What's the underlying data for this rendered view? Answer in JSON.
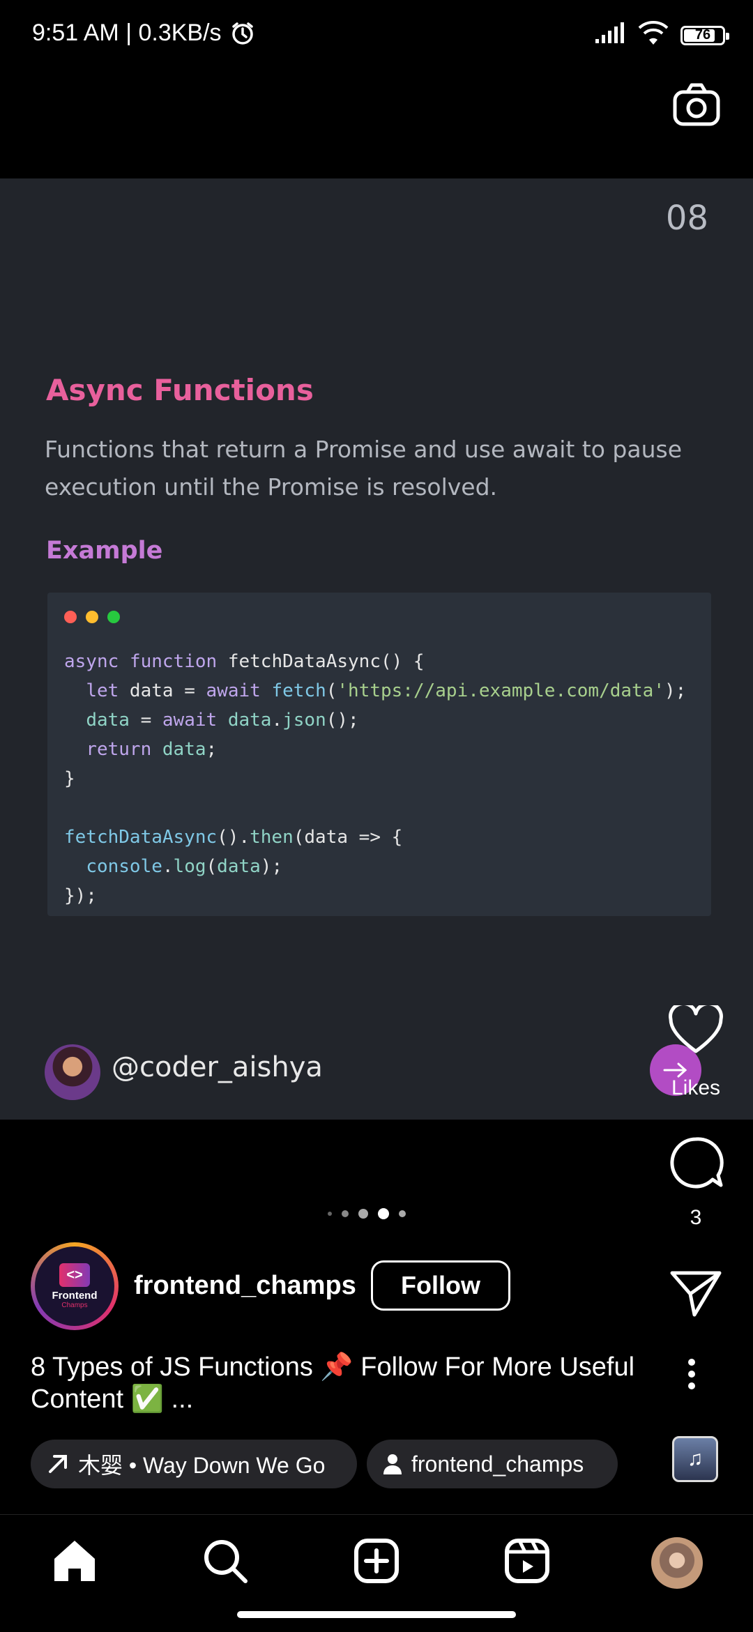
{
  "status_bar": {
    "time_speed": "9:51 AM | 0.3KB/s",
    "battery_level": "76"
  },
  "post": {
    "page_number": "08",
    "title": "Async Functions",
    "description": "Functions that return a Promise and use await to pause execution until the Promise is resolved.",
    "example_label": "Example",
    "author_handle": "@coder_aishya"
  },
  "actions": {
    "likes_label": "Likes",
    "comment_count": "3"
  },
  "account": {
    "name": "frontend_champs",
    "logo_text": "Frontend",
    "logo_subtext": "Champs",
    "follow_label": "Follow"
  },
  "caption": "8 Types of JS Functions 📌 Follow For More Useful Content ✅ ...",
  "chips": {
    "audio_label": "木婴 • Way Down We Go",
    "tagged_user": "frontend_champs"
  },
  "colors": {
    "card_bg": "#22252b",
    "title_pink": "#e8609c",
    "example_purple": "#c57ad6",
    "code_bg": "#2b313a"
  }
}
